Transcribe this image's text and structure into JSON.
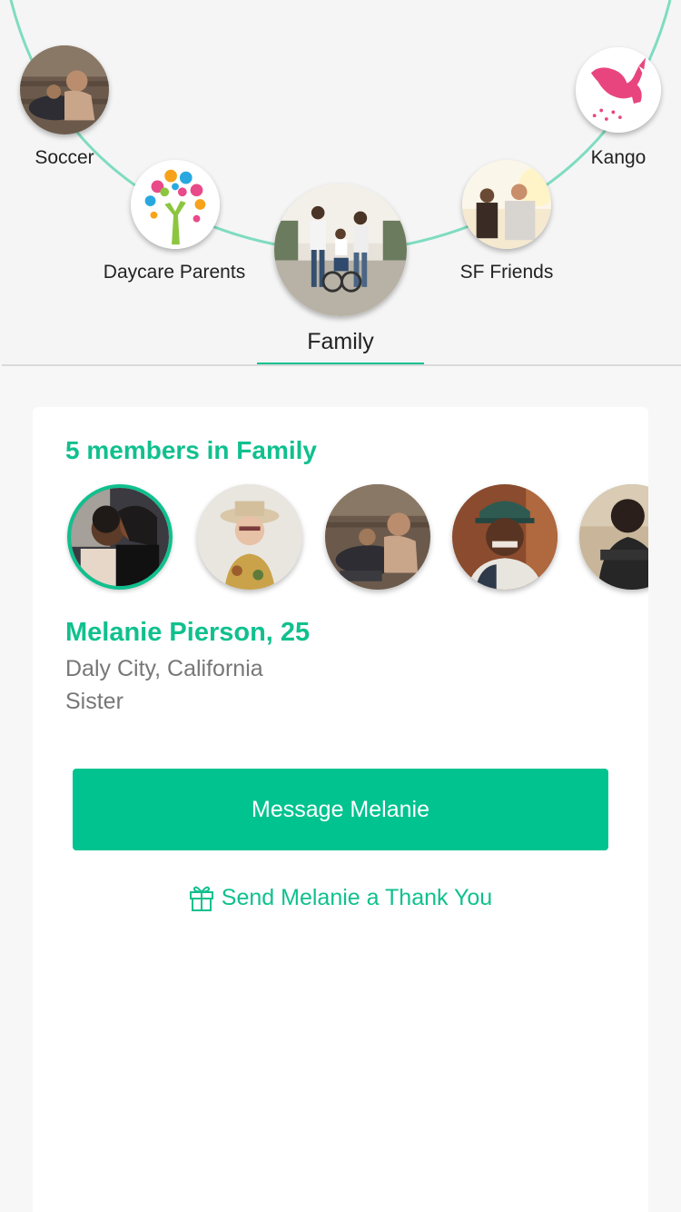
{
  "groups": {
    "items": [
      {
        "label": "Soccer"
      },
      {
        "label": "Daycare Parents"
      },
      {
        "label": "Family"
      },
      {
        "label": "SF Friends"
      },
      {
        "label": "Kango"
      }
    ]
  },
  "card": {
    "title": "5 members in Family",
    "members": [
      {
        "photo": "two-women-portrait"
      },
      {
        "photo": "woman-with-hat-portrait"
      },
      {
        "photo": "woman-with-dog-portrait"
      },
      {
        "photo": "man-with-cap-portrait"
      },
      {
        "photo": "man-in-shadow-portrait"
      }
    ],
    "selected": {
      "name": "Melanie Pierson, 25",
      "location": "Daly City, California",
      "relation": "Sister"
    },
    "message_button": "Message Melanie",
    "thank_you_link": "Send Melanie a Thank You"
  },
  "colors": {
    "accent": "#10c08e",
    "button": "#00c38f",
    "arc": "#7fdcc0",
    "kango_pink": "#e8457f"
  }
}
